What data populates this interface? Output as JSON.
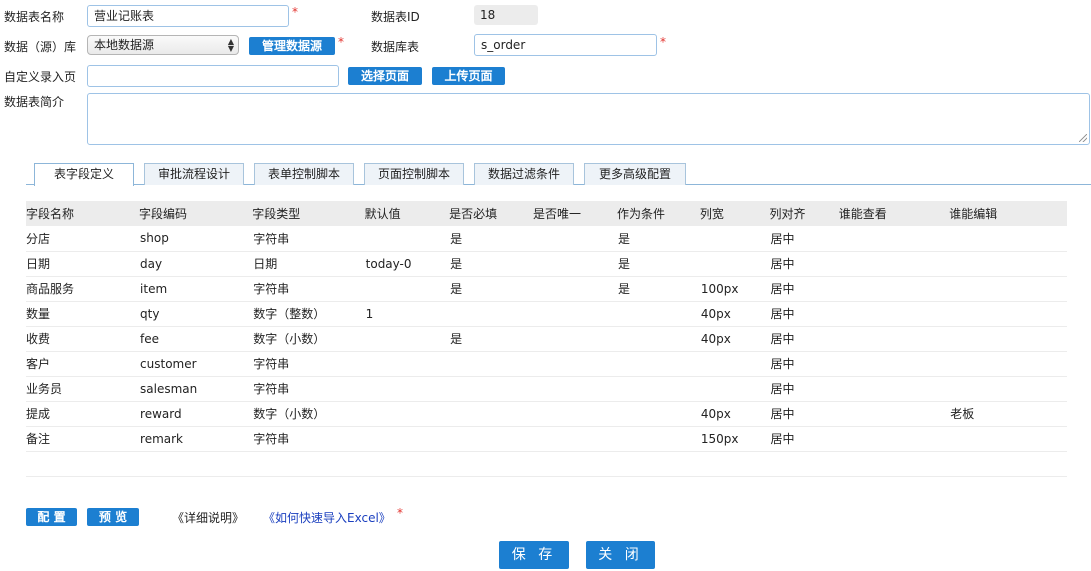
{
  "form": {
    "name_label": "数据表名称",
    "name_value": "营业记账表",
    "id_label": "数据表ID",
    "id_value": "18",
    "source_label": "数据（源）库",
    "source_value": "本地数据源",
    "manage_source_btn": "管理数据源",
    "dbtable_label": "数据库表",
    "dbtable_value": "s_order",
    "custom_page_label": "自定义录入页",
    "custom_page_value": "",
    "choose_page_btn": "选择页面",
    "upload_page_btn": "上传页面",
    "desc_label": "数据表简介",
    "desc_value": "",
    "required_mark": "*"
  },
  "tabs": [
    {
      "label": "表字段定义",
      "active": true
    },
    {
      "label": "审批流程设计",
      "active": false
    },
    {
      "label": "表单控制脚本",
      "active": false
    },
    {
      "label": "页面控制脚本",
      "active": false
    },
    {
      "label": "数据过滤条件",
      "active": false
    },
    {
      "label": "更多高级配置",
      "active": false
    }
  ],
  "table": {
    "columns": [
      "字段名称",
      "字段编码",
      "字段类型",
      "默认值",
      "是否必填",
      "是否唯一",
      "作为条件",
      "列宽",
      "列对齐",
      "谁能查看",
      "谁能编辑"
    ],
    "rows": [
      [
        "分店",
        "shop",
        "字符串",
        "",
        "是",
        "",
        "是",
        "",
        "居中",
        "",
        ""
      ],
      [
        "日期",
        "day",
        "日期",
        "today-0",
        "是",
        "",
        "是",
        "",
        "居中",
        "",
        ""
      ],
      [
        "商品服务",
        "item",
        "字符串",
        "",
        "是",
        "",
        "是",
        "100px",
        "居中",
        "",
        ""
      ],
      [
        "数量",
        "qty",
        "数字（整数）",
        "1",
        "",
        "",
        "",
        "40px",
        "居中",
        "",
        ""
      ],
      [
        "收费",
        "fee",
        "数字（小数）",
        "",
        "是",
        "",
        "",
        "40px",
        "居中",
        "",
        ""
      ],
      [
        "客户",
        "customer",
        "字符串",
        "",
        "",
        "",
        "",
        "",
        "居中",
        "",
        ""
      ],
      [
        "业务员",
        "salesman",
        "字符串",
        "",
        "",
        "",
        "",
        "",
        "居中",
        "",
        ""
      ],
      [
        "提成",
        "reward",
        "数字（小数）",
        "",
        "",
        "",
        "",
        "40px",
        "居中",
        "",
        "老板"
      ],
      [
        "备注",
        "remark",
        "字符串",
        "",
        "",
        "",
        "",
        "150px",
        "居中",
        "",
        ""
      ]
    ]
  },
  "footer": {
    "config_btn": "配 置",
    "preview_btn": "预 览",
    "detail_link": "《详细说明》",
    "excel_link": "《如何快速导入Excel》",
    "required_mark": "*",
    "save_btn": "保 存",
    "close_btn": "关 闭"
  },
  "colors": {
    "accent": "#1c7fd1",
    "required": "#e3342f",
    "link": "#1a3fbf"
  }
}
